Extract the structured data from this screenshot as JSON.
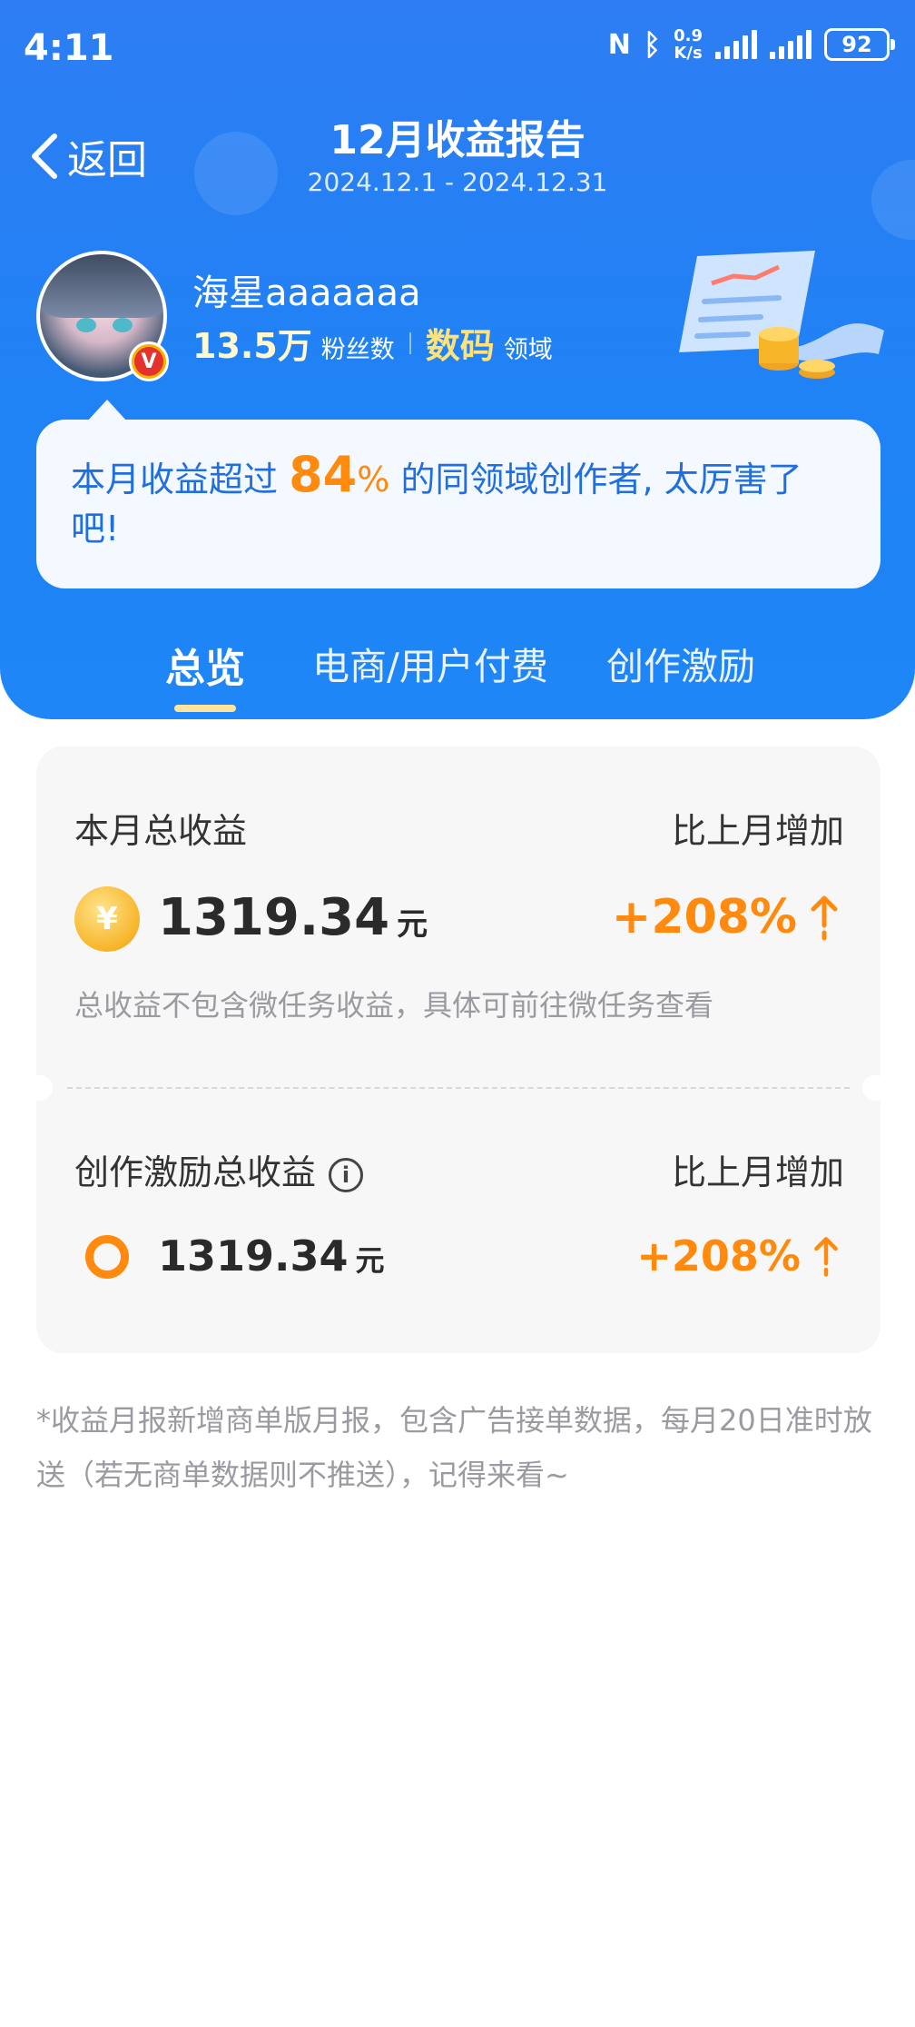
{
  "status_bar": {
    "time": "4:11",
    "nfc": "N",
    "net_speed_value": "0.9",
    "net_speed_unit": "K/s",
    "battery": "92"
  },
  "header": {
    "back_label": "返回",
    "title": "12月收益报告",
    "date_range": "2024.12.1 - 2024.12.31"
  },
  "profile": {
    "username": "海星aaaaaaa",
    "fans_count": "13.5万",
    "fans_label": "粉丝数",
    "field": "数码",
    "field_label": "领域",
    "badge": "V"
  },
  "bubble": {
    "prefix": "本月收益超过",
    "percent": "84",
    "percent_sign": "%",
    "suffix": "的同领域创作者, 太厉害了吧!"
  },
  "tabs": [
    {
      "label": "总览",
      "active": true
    },
    {
      "label": "电商/用户付费",
      "active": false
    },
    {
      "label": "创作激励",
      "active": false
    }
  ],
  "total_income": {
    "label": "本月总收益",
    "compare_label": "比上月增加",
    "currency_symbol": "¥",
    "amount": "1319.34",
    "unit": "元",
    "growth": "+208%",
    "note": "总收益不包含微任务收益，具体可前往微任务查看"
  },
  "incentive_income": {
    "label": "创作激励总收益",
    "info_glyph": "i",
    "compare_label": "比上月增加",
    "amount": "1319.34",
    "unit": "元",
    "growth": "+208%"
  },
  "footer_note": "*收益月报新增商单版月报，包含广告接单数据，每月20日准时放送（若无商单数据则不推送），记得来看~",
  "colors": {
    "primary_blue": "#1f82f5",
    "accent_orange": "#ff8a0d",
    "highlight_yellow": "#ffe27a"
  }
}
